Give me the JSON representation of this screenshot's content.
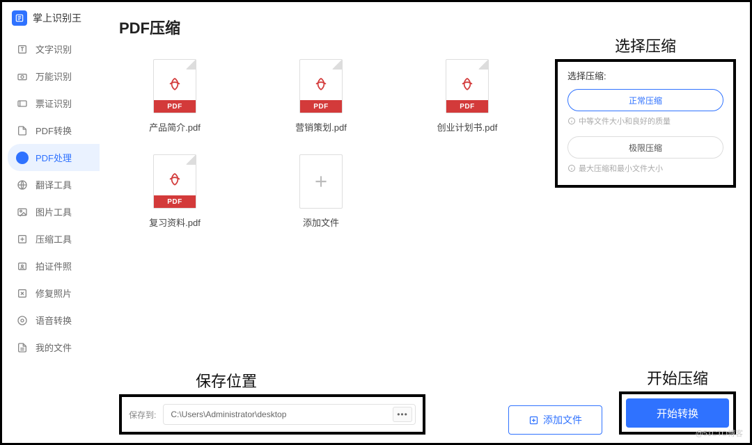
{
  "app": {
    "name": "掌上识别王"
  },
  "sidebar": {
    "items": [
      {
        "label": "文字识别"
      },
      {
        "label": "万能识别"
      },
      {
        "label": "票证识别"
      },
      {
        "label": "PDF转换"
      },
      {
        "label": "PDF处理"
      },
      {
        "label": "翻译工具"
      },
      {
        "label": "图片工具"
      },
      {
        "label": "压缩工具"
      },
      {
        "label": "拍证件照"
      },
      {
        "label": "修复照片"
      },
      {
        "label": "语音转换"
      },
      {
        "label": "我的文件"
      }
    ]
  },
  "page": {
    "title": "PDF压缩",
    "files": [
      {
        "band": "PDF",
        "name": "产品简介.pdf"
      },
      {
        "band": "PDF",
        "name": "营销策划.pdf"
      },
      {
        "band": "PDF",
        "name": "创业计划书.pdf"
      },
      {
        "band": "PDF",
        "name": "复习资料.pdf"
      }
    ],
    "add_tile_label": "添加文件"
  },
  "annotations": {
    "compress": "选择压缩",
    "save": "保存位置",
    "start": "开始压缩"
  },
  "compress_panel": {
    "label": "选择压缩:",
    "option_normal": "正常压缩",
    "hint_normal": "中等文件大小和良好的质量",
    "option_max": "极限压缩",
    "hint_max": "最大压缩和最小文件大小"
  },
  "footer": {
    "save_label": "保存到:",
    "path_value": "C:\\Users\\Administrator\\desktop",
    "path_more": "•••",
    "add_file": "添加文件",
    "start": "开始转换"
  },
  "watermark": "@51CTO博客"
}
